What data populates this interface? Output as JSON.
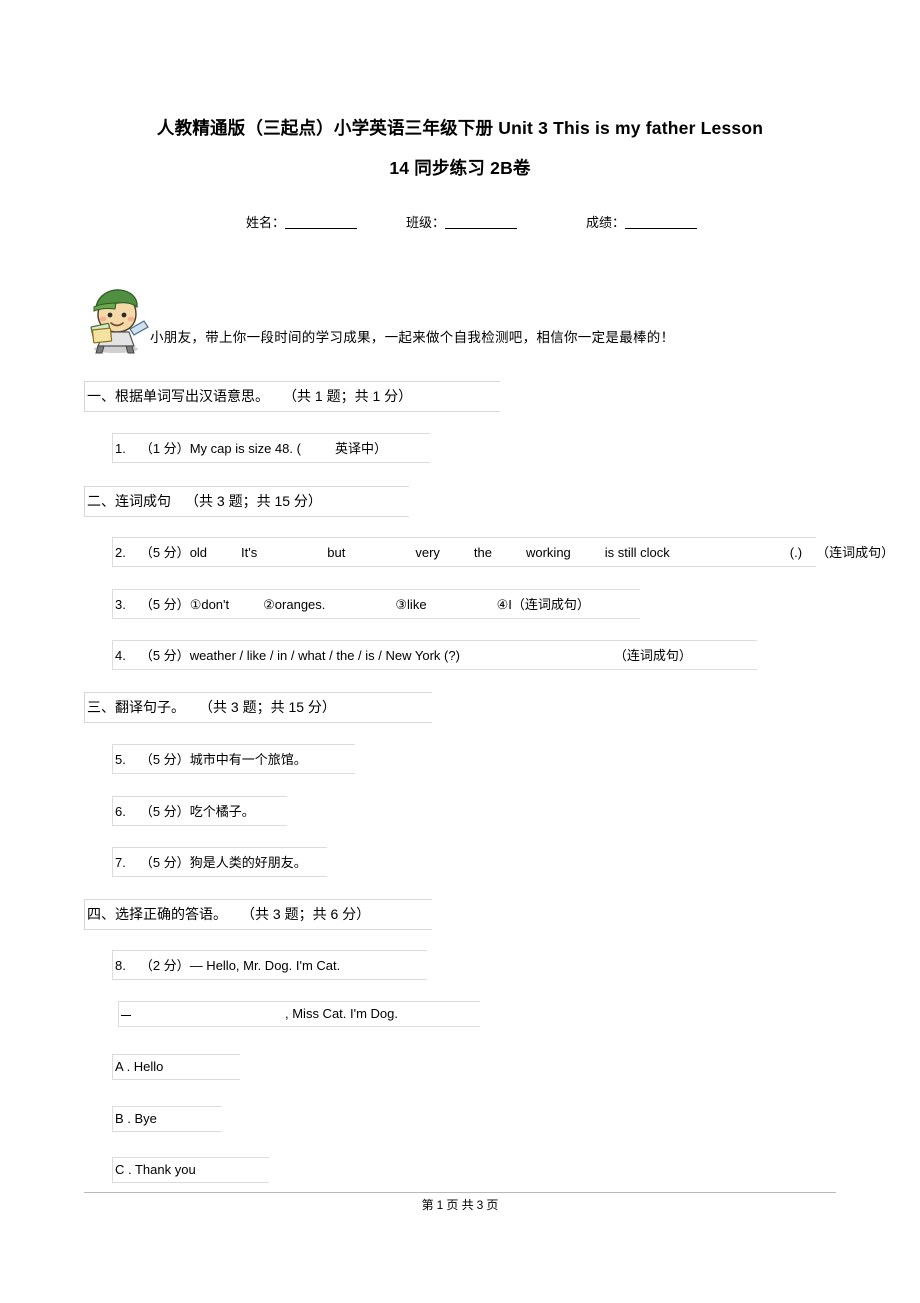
{
  "document": {
    "title_line1": "人教精通版（三起点）小学英语三年级下册    Unit 3 This is my father Lesson",
    "title_line2": "14 同步练习 2B卷",
    "meta": {
      "name_label": "姓名：",
      "class_label": "班级：",
      "score_label": "成绩："
    },
    "intro": "小朋友，带上你一段时间的学习成果，一起来做个自我检测吧，相信你一定是最棒的！",
    "sections": [
      {
        "num": "一、",
        "title": "根据单词写出汉语意思。",
        "count": "（共 1 题；共 1 分）",
        "questions": [
          {
            "num": "1.",
            "pts": "（1 分）",
            "text": "My cap is size 48. (",
            "tag": "英译中",
            "tail": "）"
          }
        ]
      },
      {
        "num": "二、",
        "title": "连词成句",
        "count": "（共 3 题；共 15 分）",
        "questions": [
          {
            "num": "2.",
            "pts": "（5 分）",
            "w1": "old",
            "w2": "It's",
            "w3": "but",
            "w4": "very",
            "w5": "the",
            "w6": "working",
            "w7": "is still clock",
            "w8": "(.)",
            "tag": "（连词成句）"
          },
          {
            "num": "3.",
            "pts": "（5 分）",
            "w1": "①don't",
            "w2": "②oranges.",
            "w3": "③like",
            "w4": "④I",
            "tag": "（连词成句）"
          },
          {
            "num": "4.",
            "pts": "（5 分）",
            "w1": "weather / like / in / what / the / is / New York (?)",
            "tag": "（连词成句）"
          }
        ]
      },
      {
        "num": "三、",
        "title": "翻译句子。",
        "count": "（共 3 题；共 15 分）",
        "questions": [
          {
            "num": "5.",
            "pts": "（5 分）",
            "text": "城市中有一个旅馆。"
          },
          {
            "num": "6.",
            "pts": "（5 分）",
            "text": "吃个橘子。"
          },
          {
            "num": "7.",
            "pts": "（5 分）",
            "text": "狗是人类的好朋友。"
          }
        ]
      },
      {
        "num": "四、",
        "title": "选择正确的答语。",
        "count": "（共 3 题；共 6 分）",
        "questions": [
          {
            "num": "8.",
            "pts": "（2 分）",
            "text": "— Hello, Mr. Dog. I'm Cat.",
            "answer_line": ", Miss Cat. I'm Dog.",
            "options": [
              "A . Hello",
              "B . Bye",
              "C . Thank you"
            ]
          }
        ]
      }
    ],
    "footer": {
      "prefix": "第",
      "current": "1",
      "mid": "页 共",
      "total": "3",
      "suffix": "页"
    }
  }
}
